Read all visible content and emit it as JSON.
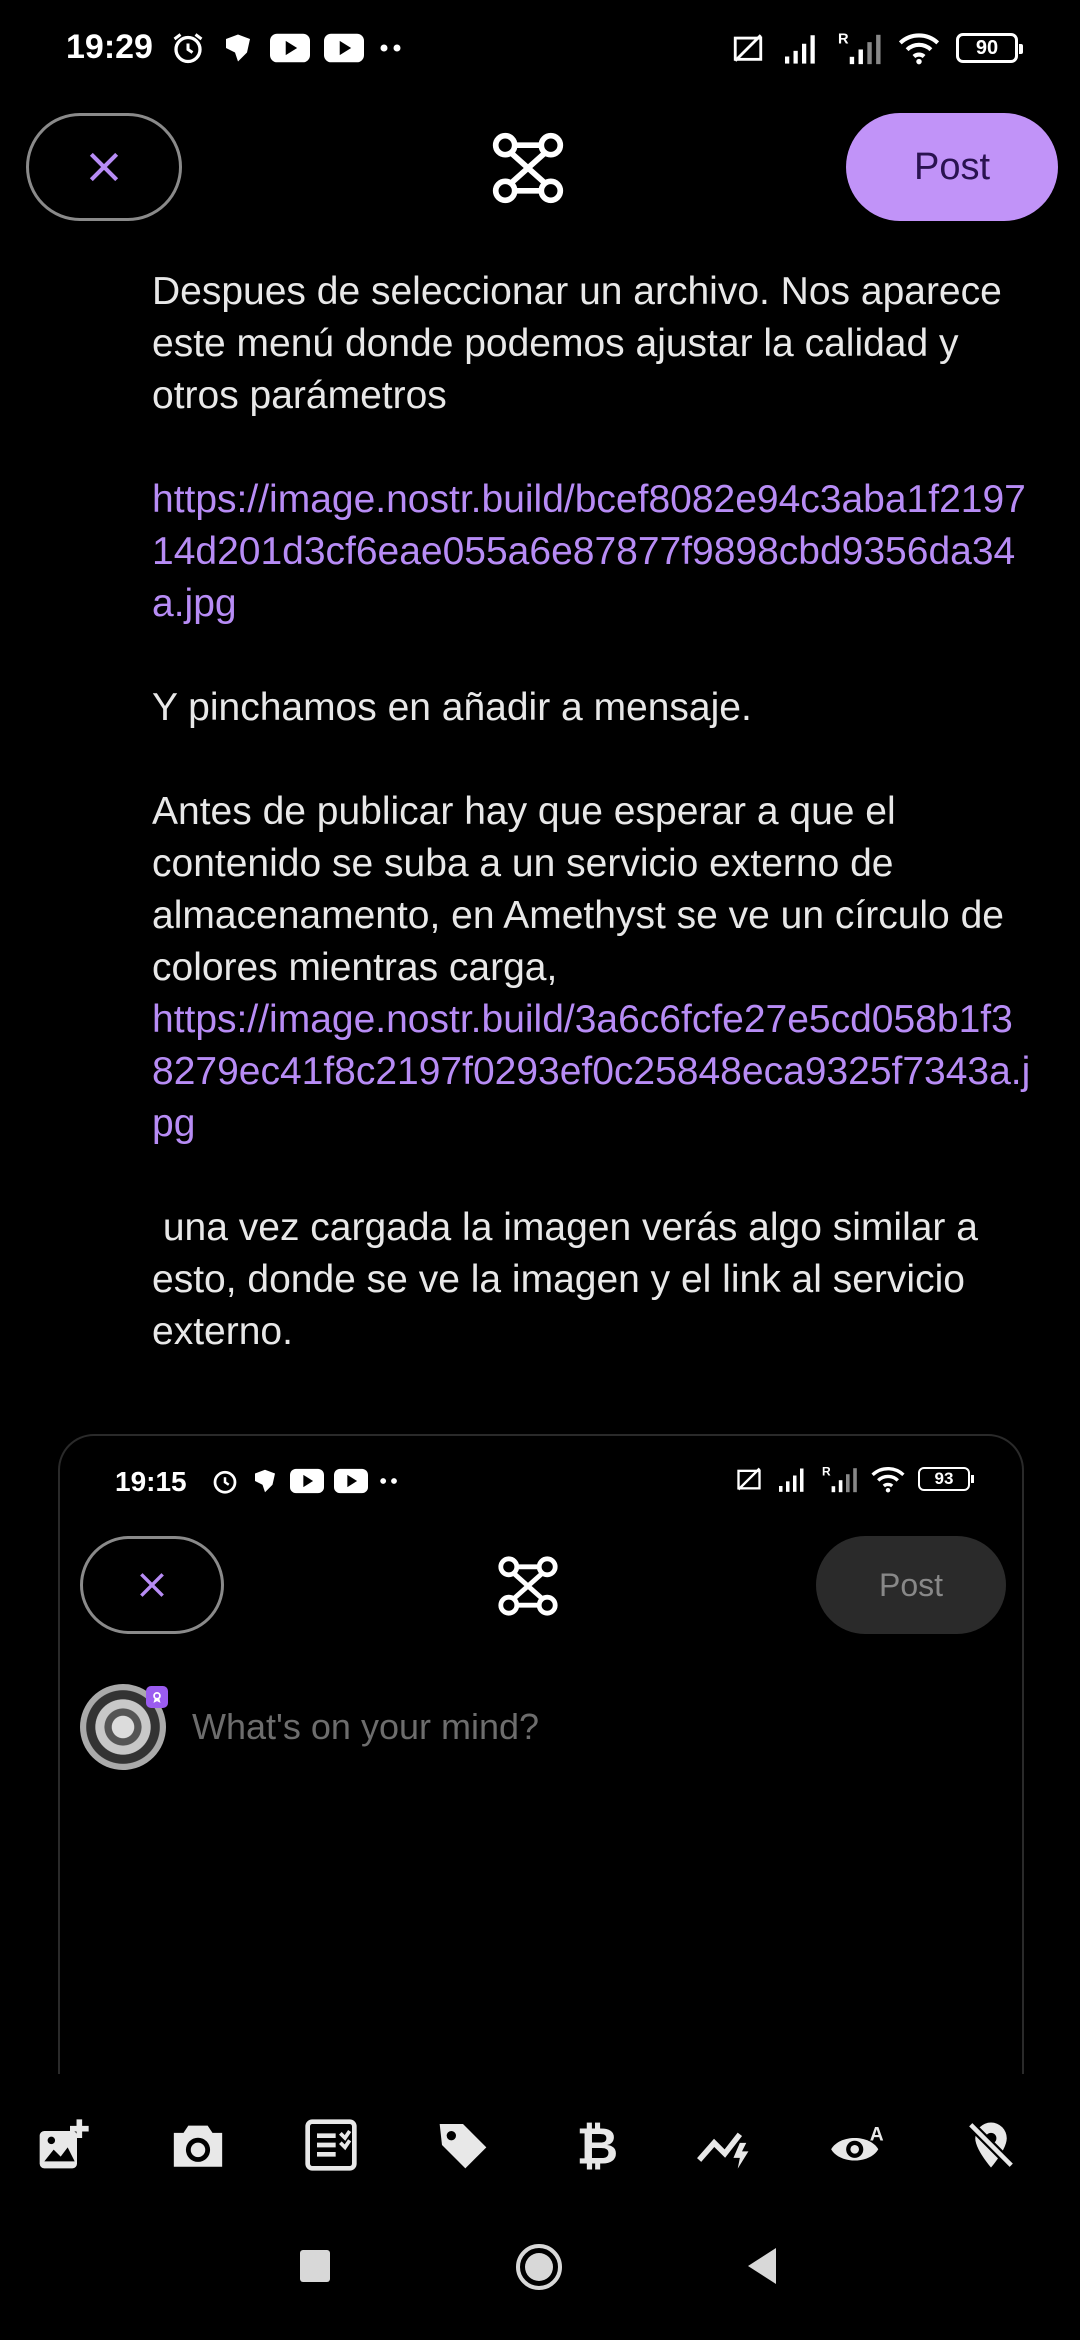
{
  "status_bar": {
    "time": "19:29",
    "battery": "90",
    "left_icons": [
      "alarm-icon",
      "chat-icon",
      "youtube-icon",
      "youtube-icon",
      "more-dots-icon"
    ],
    "right_icons": [
      "data-off-icon",
      "signal-icon",
      "roaming-signal-icon",
      "wifi-icon",
      "battery-icon"
    ]
  },
  "header": {
    "close_icon": "close-icon",
    "logo_icon": "nostr-network-icon",
    "post_label": "Post"
  },
  "message": {
    "p1": "Despues de seleccionar un archivo. Nos aparece este menú donde podemos ajustar la calidad y otros parámetros",
    "link1": "https://image.nostr.build/bcef8082e94c3aba1f219714d201d3cf6eae055a6e87877f9898cbd9356da34a.jpg",
    "p2": "Y pinchamos en añadir a mensaje.",
    "p3": "Antes de publicar hay que esperar a que el contenido se suba a un servicio externo de almacenamento, en Amethyst se ve un círculo de colores mientras carga,",
    "link2": "https://image.nostr.build/3a6c6fcfe27e5cd058b1f38279ec41f8c2197f0293ef0c25848eca9325f7343a.jpg",
    "p4": " una vez cargada la imagen verás algo similar a esto, donde se ve la imagen y el link al servicio externo."
  },
  "embedded_screenshot": {
    "time": "19:15",
    "battery": "93",
    "post_label": "Post",
    "placeholder": "What's on your mind?"
  },
  "toolbar": {
    "icons": [
      "add-image-icon",
      "camera-icon",
      "poll-icon",
      "tag-icon",
      "bitcoin-icon",
      "zap-split-icon",
      "content-warning-icon",
      "location-off-icon"
    ]
  },
  "colors": {
    "accent": "#c193f8",
    "link": "#b78cf5",
    "background": "#000000"
  }
}
